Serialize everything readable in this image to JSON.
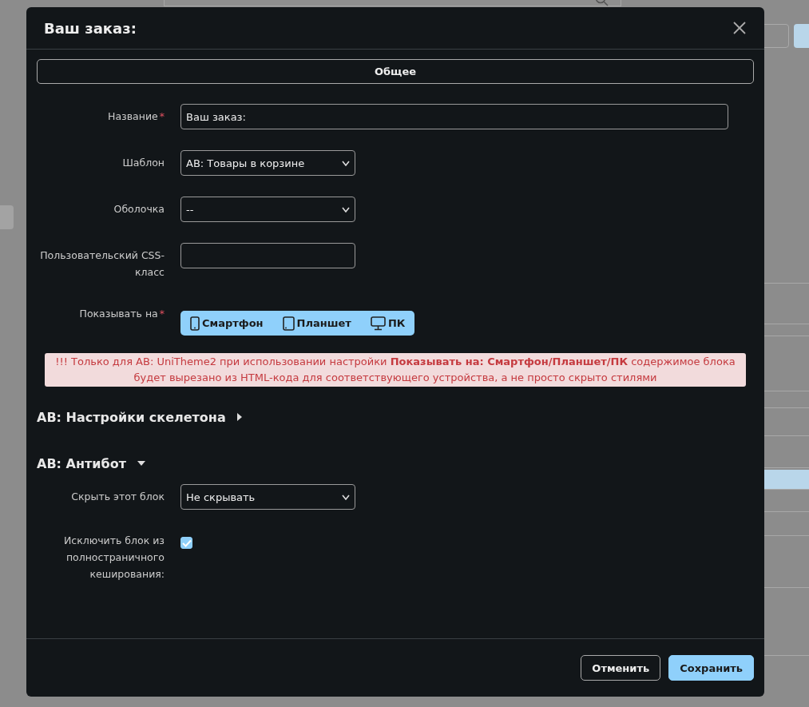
{
  "dialog": {
    "title": "Ваш заказ:",
    "tabs": [
      {
        "label": "Общее",
        "selected": true
      }
    ],
    "fields": [
      {
        "kind": "text",
        "label": "Название",
        "required_mark": "*",
        "value": "Ваш заказ:",
        "wide": true
      },
      {
        "kind": "select",
        "label": "Шаблон",
        "value": "AB: Товары в корзине"
      },
      {
        "kind": "select",
        "label": "Оболочка",
        "value": "--"
      },
      {
        "kind": "text",
        "label": "Пользовательский CSS-класс",
        "wide": false
      },
      {
        "kind": "devices",
        "label": "Показывать на",
        "required_mark": "*",
        "options": [
          {
            "kind": "phone",
            "label": "Смартфон",
            "selected": true
          },
          {
            "kind": "tablet",
            "label": "Планшет",
            "selected": true
          },
          {
            "kind": "desktop",
            "label": "ПК",
            "selected": true
          }
        ]
      }
    ],
    "notice": "!!! Только для AB: UniTheme2 при использовании настройки **Показывать на: Смартфон/Планшет/ПК** содержимое блока будет вырезано из HTML-кода для соответствующего устройства, а не просто скрыто стилями",
    "sections": [
      {
        "title": "AB: Настройки скелетона",
        "expanded": false
      },
      {
        "title": "AB: Антибот",
        "expanded": true,
        "fields": [
          {
            "kind": "select",
            "label": "Скрыть этот блок",
            "value": "Не скрывать"
          },
          {
            "kind": "checkbox",
            "label": "Исключить блок из полностраничного кеширования:",
            "checked": true
          }
        ]
      }
    ],
    "buttons": [
      {
        "kind": "secondary",
        "label": "Отменить"
      },
      {
        "kind": "primary",
        "label": "Сохранить"
      }
    ]
  }
}
